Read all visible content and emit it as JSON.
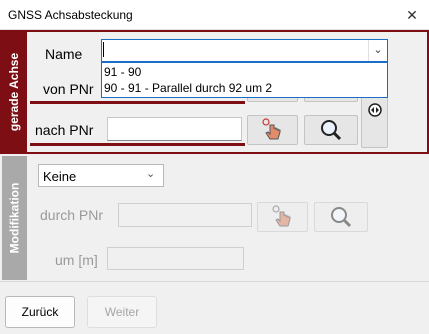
{
  "window": {
    "title": "GNSS Achsabsteckung",
    "close_glyph": "✕"
  },
  "section1": {
    "side_label": "gerade Achse",
    "name_label": "Name",
    "name_value": "",
    "von_label": "von PNr",
    "nach_label": "nach PNr",
    "dropdown_items": [
      "91 - 90",
      "90 - 91 - Parallel durch 92 um 2"
    ],
    "accent_color": "#7d0f14"
  },
  "section2": {
    "side_label": "Modifikation",
    "select_value": "Keine",
    "durch_label": "durch PNr",
    "um_label": "um [m]",
    "side_color": "#a9a9a9"
  },
  "footer": {
    "back_label": "Zurück",
    "next_label": "Weiter"
  }
}
